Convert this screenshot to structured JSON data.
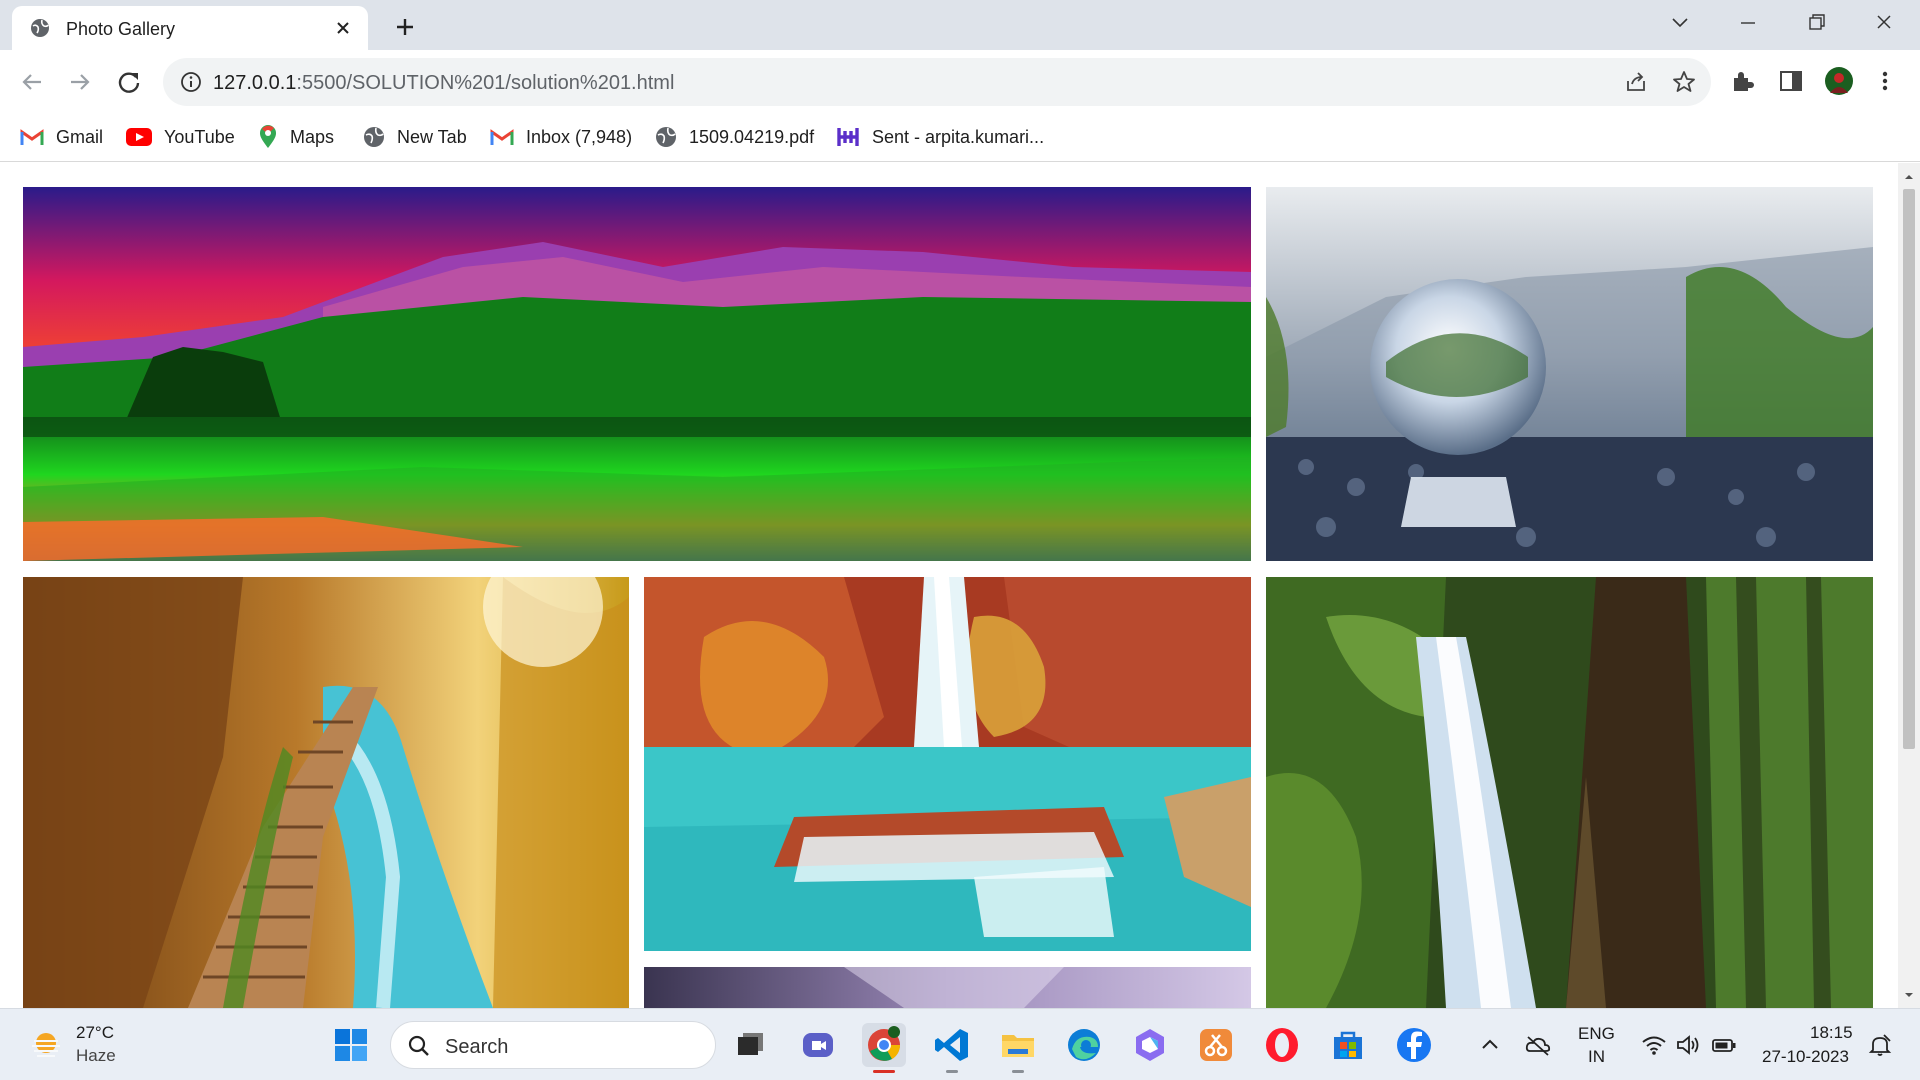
{
  "browser": {
    "tab_title": "Photo Gallery",
    "url_host": "127.0.0.1",
    "url_rest": ":5500/SOLUTION%201/solution%201.html"
  },
  "bookmarks": [
    {
      "label": "Gmail",
      "icon": "gmail-icon"
    },
    {
      "label": "YouTube",
      "icon": "youtube-icon"
    },
    {
      "label": "Maps",
      "icon": "maps-icon"
    },
    {
      "label": "New Tab",
      "icon": "globe-icon"
    },
    {
      "label": "Inbox (7,948)",
      "icon": "gmail-icon"
    },
    {
      "label": "1509.04219.pdf",
      "icon": "globe-icon"
    },
    {
      "label": "Sent - arpita.kumari...",
      "icon": "hive-icon"
    }
  ],
  "gallery": {
    "photos": [
      {
        "subject": "mountain-lake-sunset",
        "icon": "landscape-photo"
      },
      {
        "subject": "crystal-ball",
        "icon": "crystal-ball-photo"
      },
      {
        "subject": "forest-boardwalk",
        "icon": "boardwalk-photo"
      },
      {
        "subject": "canyon-waterfall",
        "icon": "waterfall-photo"
      },
      {
        "subject": "forest-waterfall",
        "icon": "waterfall-photo"
      },
      {
        "subject": "purple-sky",
        "icon": "sky-photo"
      }
    ]
  },
  "taskbar": {
    "temperature": "27°C",
    "condition": "Haze",
    "search_placeholder": "Search",
    "language": "ENG",
    "region": "IN",
    "time": "18:15",
    "date": "27-10-2023"
  },
  "colors": {
    "titlebar": "#dee3ea",
    "omnibox": "#f1f3f4",
    "taskbar": "#e9eef5",
    "accent_blue": "#0067c0"
  }
}
